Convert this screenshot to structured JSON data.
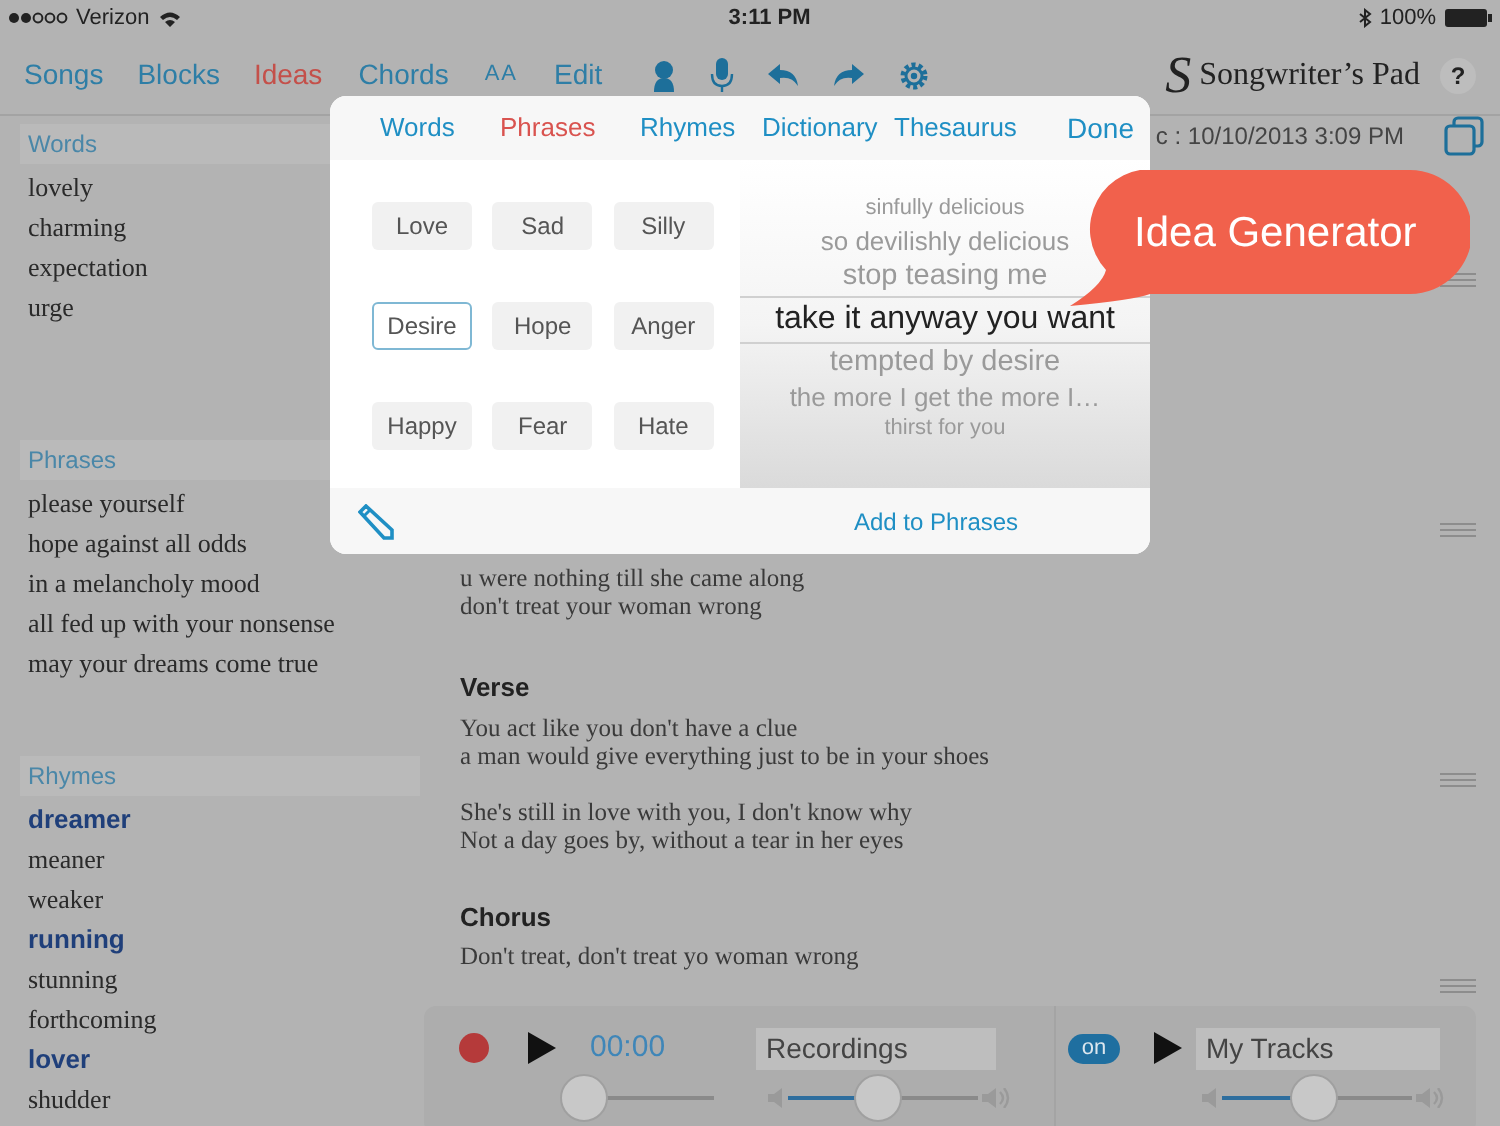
{
  "status_bar": {
    "carrier": "Verizon",
    "time": "3:11 PM",
    "battery": "100%"
  },
  "toolbar": {
    "tabs": [
      {
        "label": "Songs",
        "selected": false
      },
      {
        "label": "Blocks",
        "selected": false
      },
      {
        "label": "Ideas",
        "selected": true
      },
      {
        "label": "Chords",
        "selected": false
      }
    ],
    "text_size": "AA",
    "edit": "Edit",
    "app_logo": "S",
    "app_title": "Songwriter’s Pad",
    "help": "?"
  },
  "sidebar": [
    {
      "title": "Words",
      "items": [
        {
          "text": "lovely",
          "highlighted": false
        },
        {
          "text": "charming",
          "highlighted": false
        },
        {
          "text": "expectation",
          "highlighted": false
        },
        {
          "text": "urge",
          "highlighted": false
        }
      ]
    },
    {
      "title": "Phrases",
      "items": [
        {
          "text": "please yourself",
          "highlighted": false
        },
        {
          "text": "hope against all odds",
          "highlighted": false
        },
        {
          "text": "in a melancholy mood",
          "highlighted": false
        },
        {
          "text": "all fed up with your nonsense",
          "highlighted": false
        },
        {
          "text": "may your dreams come true",
          "highlighted": false
        }
      ]
    },
    {
      "title": "Rhymes",
      "items": [
        {
          "text": "dreamer",
          "highlighted": true
        },
        {
          "text": "meaner",
          "highlighted": false
        },
        {
          "text": "weaker",
          "highlighted": false
        },
        {
          "text": "running",
          "highlighted": true
        },
        {
          "text": "stunning",
          "highlighted": false
        },
        {
          "text": "forthcoming",
          "highlighted": false
        },
        {
          "text": "lover",
          "highlighted": true
        },
        {
          "text": "shudder",
          "highlighted": false
        }
      ]
    }
  ],
  "song": {
    "date": "c : 10/10/2013 3:09 PM",
    "blocks": [
      {
        "stanzas": [
          [
            "u were nothing till she came along",
            "don't treat your woman wrong"
          ]
        ]
      },
      {
        "title": "Verse",
        "stanzas": [
          [
            "You act like you don't have a clue",
            "a man would give everything just to be in your shoes"
          ],
          [
            "She's still in love with you, I don't know why",
            "Not a day goes by, without a tear in her eyes"
          ]
        ]
      },
      {
        "title": "Chorus",
        "stanzas": [
          [
            "Don't treat, don't treat yo woman wrong"
          ]
        ]
      }
    ]
  },
  "player": {
    "time": "00:00",
    "seek": {
      "level": 0.1
    },
    "recordings": "Recordings",
    "recordings_volume": {
      "level": 0.47
    },
    "tracks_toggle": "on",
    "tracks": "My Tracks",
    "tracks_volume": {
      "level": 0.48
    }
  },
  "popup": {
    "tabs": [
      {
        "label": "Words",
        "selected": false
      },
      {
        "label": "Phrases",
        "selected": true
      },
      {
        "label": "Rhymes",
        "selected": false
      },
      {
        "label": "Dictionary",
        "selected": false
      },
      {
        "label": "Thesaurus",
        "selected": false
      }
    ],
    "done": "Done",
    "moods": [
      {
        "label": "Love",
        "selected": false
      },
      {
        "label": "Sad",
        "selected": false
      },
      {
        "label": "Silly",
        "selected": false
      },
      {
        "label": "Desire",
        "selected": true
      },
      {
        "label": "Hope",
        "selected": false
      },
      {
        "label": "Anger",
        "selected": false
      },
      {
        "label": "Happy",
        "selected": false
      },
      {
        "label": "Fear",
        "selected": false
      },
      {
        "label": "Hate",
        "selected": false
      }
    ],
    "picker": [
      {
        "text": "sinfully delicious",
        "selected": false
      },
      {
        "text": "so devilishly delicious",
        "selected": false
      },
      {
        "text": "stop teasing me",
        "selected": false
      },
      {
        "text": "take it anyway you want",
        "selected": true
      },
      {
        "text": "tempted by desire",
        "selected": false
      },
      {
        "text": "the more I get the more I…",
        "selected": false
      },
      {
        "text": "thirst for you",
        "selected": false
      }
    ],
    "add_button": "Add to Phrases"
  },
  "callout": "Idea Generator"
}
